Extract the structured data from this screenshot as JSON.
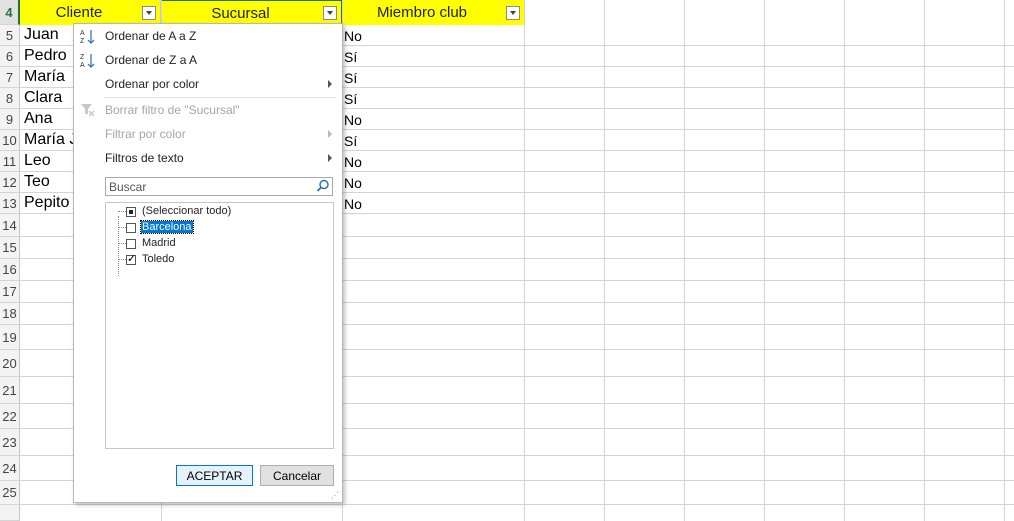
{
  "columns": [
    {
      "label": "Cliente"
    },
    {
      "label": "Sucursal"
    },
    {
      "label": "Miembro club"
    }
  ],
  "header_row_number": "4",
  "rows": [
    {
      "num": "5",
      "cliente": "Juan",
      "miembro": "No"
    },
    {
      "num": "6",
      "cliente": "Pedro",
      "miembro": "Sí"
    },
    {
      "num": "7",
      "cliente": "María",
      "miembro": "Sí"
    },
    {
      "num": "8",
      "cliente": "Clara",
      "miembro": "Sí"
    },
    {
      "num": "9",
      "cliente": "Ana",
      "miembro": "No"
    },
    {
      "num": "10",
      "cliente": "María J",
      "miembro": "Sí"
    },
    {
      "num": "11",
      "cliente": "Leo",
      "miembro": "No"
    },
    {
      "num": "12",
      "cliente": "Teo",
      "miembro": "No"
    },
    {
      "num": "13",
      "cliente": "Pepito",
      "miembro": "No"
    }
  ],
  "empty_rows": [
    "14",
    "15",
    "16",
    "17",
    "18",
    "19",
    "20",
    "21",
    "22",
    "23",
    "24",
    "25"
  ],
  "filter_menu": {
    "sort_az": "Ordenar de A a Z",
    "sort_za": "Ordenar de Z a A",
    "sort_color": "Ordenar por color",
    "clear_filter": "Borrar filtro de \"Sucursal\"",
    "filter_color": "Filtrar por color",
    "text_filters": "Filtros de texto",
    "search_placeholder": "Buscar",
    "items": [
      {
        "label": "(Seleccionar todo)",
        "state": "partial"
      },
      {
        "label": "Barcelona",
        "state": "unchecked",
        "highlighted": true
      },
      {
        "label": "Madrid",
        "state": "unchecked"
      },
      {
        "label": "Toledo",
        "state": "checked"
      }
    ],
    "ok_label": "ACEPTAR",
    "cancel_label": "Cancelar"
  },
  "colors": {
    "header_fill": "#ffff00",
    "excel_green": "#217346",
    "selection_blue": "#0078d7"
  },
  "icons": [
    "sort-ascending-icon",
    "sort-descending-icon",
    "clear-filter-icon",
    "search-icon",
    "dropdown-arrow-icon",
    "submenu-arrow-icon"
  ]
}
